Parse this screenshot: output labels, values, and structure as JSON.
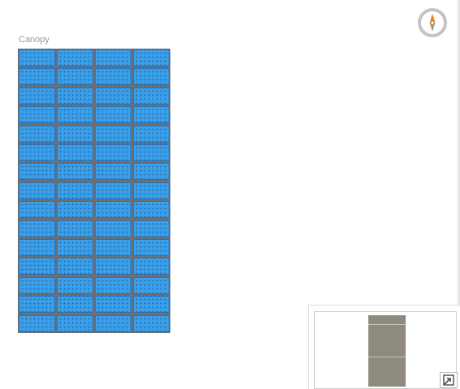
{
  "array": {
    "label": "Canopy",
    "rows": 15,
    "columns": 4
  },
  "compass": {
    "icon": "compass-icon",
    "needle_north_color": "#f07c1a",
    "needle_south_color": "#9a9a9a"
  },
  "minimap": {
    "toggle_icon": "expand-corner-icon",
    "footprint_color": "#8e8a7f"
  },
  "colors": {
    "panel_fill": "#3a9ee8",
    "panel_border": "#2b72b7",
    "array_frame": "#6f6f6f"
  }
}
